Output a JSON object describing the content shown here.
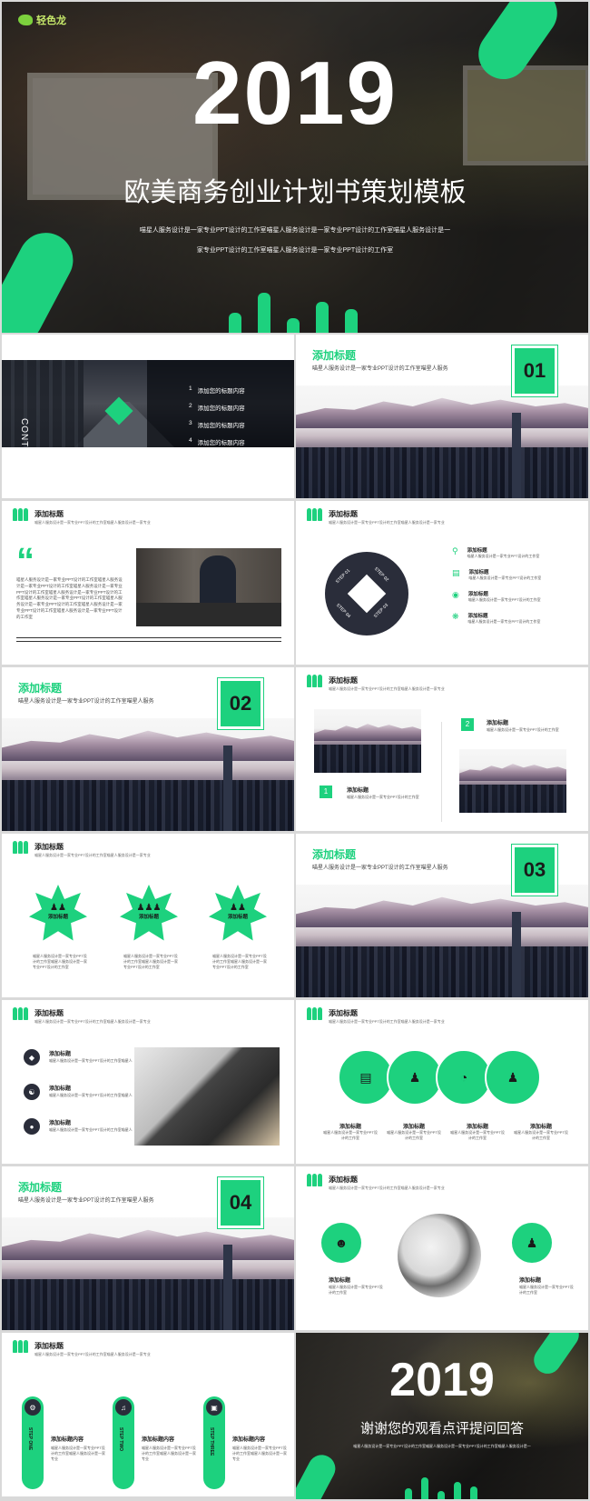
{
  "cover": {
    "logo_text": "轻色龙",
    "year": "2019",
    "title": "欧美商务创业计划书策划模板",
    "desc1": "喵星人服务设计是一家专业PPT设计的工作室喵星人服务设计是一家专业PPT设计的工作室喵星人服务设计是一",
    "desc2": "家专业PPT设计的工作室喵星人服务设计是一家专业PPT设计的工作室"
  },
  "contents": {
    "label": "CONTENTS",
    "items": [
      "添加您的标题内容",
      "添加您的标题内容",
      "添加您的标题内容",
      "添加您的标题内容"
    ],
    "nums": [
      "1",
      "2",
      "3",
      "4"
    ]
  },
  "section": {
    "title": "添加标题",
    "sub": "喵星人服务设计是一家专业PPT设计的工作室喵星人服务",
    "n1": "01",
    "n2": "02",
    "n3": "03",
    "n4": "04"
  },
  "header": {
    "title": "添加标题",
    "sub": "喵星人服务设计是一家专业PPT设计的工作室喵星人服务设计是一家专业"
  },
  "quote_slide": {
    "body": "喵星人服务设计是一家专业PPT设计的工作室喵星人服务设计是一家专业PPT设计的工作室喵星人服务设计是一家专业PPT设计的工作室喵星人服务设计是一家专业PPT设计的工作室喵星人服务设计是一家专业PPT设计的工作室喵星人服务设计是一家专业PPT设计的工作室喵星人服务设计是一家专业PPT设计的工作室喵星人服务设计是一家专业PPT设计的工作室"
  },
  "steps_slide": {
    "steps": [
      "STEP 01",
      "STEP 02",
      "STEP 03",
      "STEP 04"
    ],
    "items": [
      {
        "title": "添加标题",
        "text": "喵星人服务设计是一家专业PPT设计的工作室"
      },
      {
        "title": "添加标题",
        "text": "喵星人服务设计是一家专业PPT设计的工作室"
      },
      {
        "title": "添加标题",
        "text": "喵星人服务设计是一家专业PPT设计的工作室"
      },
      {
        "title": "添加标题",
        "text": "喵星人服务设计是一家专业PPT设计的工作室"
      }
    ]
  },
  "photo_pair": {
    "a_num": "1",
    "a_title": "添加标题",
    "a_text": "喵星人服务设计是一家专业PPT设计的工作室",
    "b_num": "2",
    "b_title": "添加标题",
    "b_text": "喵星人服务设计是一家专业PPT设计的工作室"
  },
  "stars": {
    "labels": [
      "添加标题",
      "添加标题",
      "添加标题"
    ],
    "text": "喵星人服务设计是一家专业PPT设计的工作室喵星人服务设计是一家专业PPT设计的工作室"
  },
  "list_slide": {
    "items": [
      {
        "title": "添加标题",
        "text": "喵星人服务设计是一家专业PPT设计的工作室喵星人"
      },
      {
        "title": "添加标题",
        "text": "喵星人服务设计是一家专业PPT设计的工作室喵星人"
      },
      {
        "title": "添加标题",
        "text": "喵星人服务设计是一家专业PPT设计的工作室喵星人"
      }
    ]
  },
  "circles4": {
    "items": [
      {
        "title": "添加标题",
        "text": "喵星人服务设计是一家专业PPT设计的工作室"
      },
      {
        "title": "添加标题",
        "text": "喵星人服务设计是一家专业PPT设计的工作室"
      },
      {
        "title": "添加标题",
        "text": "喵星人服务设计是一家专业PPT设计的工作室"
      },
      {
        "title": "添加标题",
        "text": "喵星人服务设计是一家专业PPT设计的工作室"
      }
    ]
  },
  "tablet_slide": {
    "left_title": "添加标题",
    "left_text": "喵星人服务设计是一家专业PPT设计的工作室",
    "right_title": "添加标题",
    "right_text": "喵星人服务设计是一家专业PPT设计的工作室"
  },
  "pills_slide": {
    "items": [
      {
        "pill": "STEP ONE",
        "title": "添加标题内容",
        "text": "喵星人服务设计是一家专业PPT设计的工作室喵星人服务设计是一家专业"
      },
      {
        "pill": "STEP TWO",
        "title": "添加标题内容",
        "text": "喵星人服务设计是一家专业PPT设计的工作室喵星人服务设计是一家专业"
      },
      {
        "pill": "STEP THREE",
        "title": "添加标题内容",
        "text": "喵星人服务设计是一家专业PPT设计的工作室喵星人服务设计是一家专业"
      }
    ]
  },
  "end": {
    "year": "2019",
    "title": "谢谢您的观看点评提问回答",
    "desc": "喵星人服务设计是一家专业PPT设计的工作室喵星人服务设计是一家专业PPT设计的工作室喵星人服务设计是一"
  },
  "colors": {
    "accent": "#1dd17e",
    "dark": "#2a2d3a"
  }
}
